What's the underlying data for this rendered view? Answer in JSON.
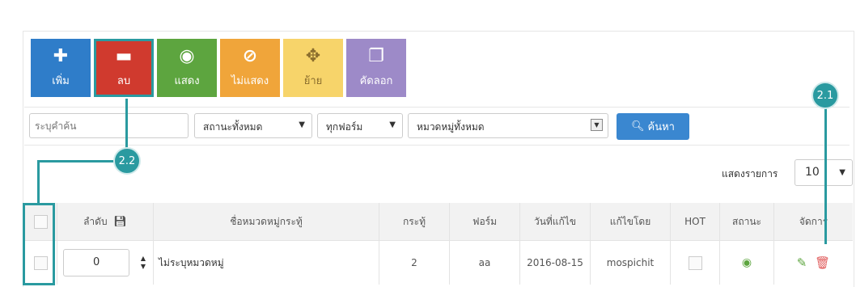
{
  "toolbar": {
    "add_label": "เพิ่ม",
    "delete_label": "ลบ",
    "show_label": "แสดง",
    "hide_label": "ไม่แสดง",
    "move_label": "ย้าย",
    "copy_label": "คัดลอก"
  },
  "filters": {
    "search_placeholder": "ระบุคำค้น",
    "status_value": "สถานะทั้งหมด",
    "form_value": "ทุกฟอร์ม",
    "category_value": "หมวดหมู่ทั้งหมด",
    "search_button": "ค้นหา"
  },
  "pagination": {
    "label": "แสดงรายการ",
    "per_page": "10"
  },
  "table": {
    "headers": {
      "order": "ลำดับ",
      "name": "ชื่อหมวดหมู่กระทู้",
      "topics": "กระทู้",
      "form": "ฟอร์ม",
      "edited_date": "วันที่แก้ไข",
      "edited_by": "แก้ไขโดย",
      "hot": "HOT",
      "status": "สถานะ",
      "manage": "จัดการ"
    },
    "rows": [
      {
        "order": "0",
        "name": "ไม่ระบุหมวดหมู่",
        "topics": "2",
        "form": "aa",
        "edited_date": "2016-08-15",
        "edited_by": "mospichit"
      }
    ]
  },
  "annotations": {
    "callout_1": "2.1",
    "callout_2": "2.2"
  },
  "icons": {
    "add": "plus-icon",
    "delete": "minus-icon",
    "show": "eye-icon",
    "hide": "eye-slash-icon",
    "move": "move-arrows-icon",
    "copy": "copy-icon",
    "search": "search-icon",
    "save": "save-icon",
    "edit": "pencil-icon",
    "trash": "trash-icon"
  },
  "colors": {
    "add": "#2f7dc9",
    "delete": "#d03a2e",
    "show": "#5da53f",
    "hide": "#f0a53a",
    "move": "#f7d46a",
    "copy": "#9d8ac8",
    "callout": "#2a9aa0"
  }
}
